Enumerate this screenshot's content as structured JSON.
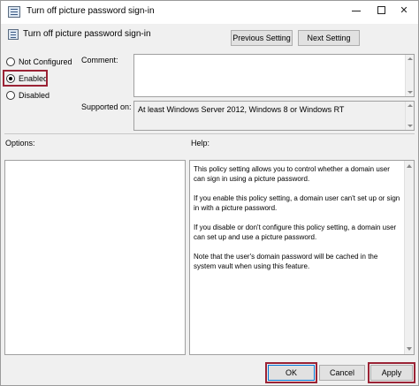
{
  "window": {
    "title": "Turn off picture password sign-in",
    "controls": {
      "minimize": "—",
      "maximize": "",
      "close": "✕"
    }
  },
  "header": {
    "title": "Turn off picture password sign-in",
    "previous_label": "Previous Setting",
    "next_label": "Next Setting"
  },
  "state": {
    "options": [
      {
        "label": "Not Configured",
        "checked": false
      },
      {
        "label": "Enabled",
        "checked": true
      },
      {
        "label": "Disabled",
        "checked": false
      }
    ]
  },
  "comment": {
    "label": "Comment:",
    "value": ""
  },
  "supported": {
    "label": "Supported on:",
    "value": "At least Windows Server 2012, Windows 8 or Windows RT"
  },
  "options_pane": {
    "label": "Options:"
  },
  "help_pane": {
    "label": "Help:",
    "paragraphs": [
      "This policy setting allows you to control whether a domain user can sign in using a picture password.",
      "If you enable this policy setting, a domain user can't set up or sign in with a picture password.",
      "If you disable or don't configure this policy setting, a domain user can set up and use a picture password.",
      "Note that the user's domain password will be cached in the system vault when using this feature."
    ]
  },
  "footer": {
    "ok_label": "OK",
    "cancel_label": "Cancel",
    "apply_label": "Apply"
  },
  "colors": {
    "highlight": "#9b2335",
    "focus_border": "#0078d7"
  },
  "icons": {
    "title_icon": "policy-icon",
    "header_icon": "policy-icon"
  }
}
